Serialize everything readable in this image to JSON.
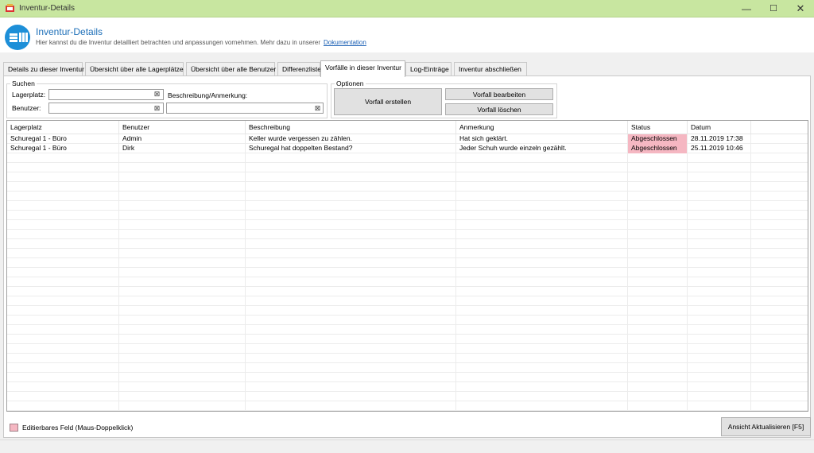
{
  "window": {
    "title": "Inventur-Details"
  },
  "header": {
    "title": "Inventur-Details",
    "subtitle": "Hier kannst du die Inventur detailliert betrachten und anpassungen vornehmen. Mehr dazu in unserer",
    "link": "Dokumentation"
  },
  "tabs": [
    {
      "label": "Details zu dieser Inventur"
    },
    {
      "label": "Übersicht über alle Lagerplätze"
    },
    {
      "label": "Übersicht über alle Benutzer"
    },
    {
      "label": "Differenzliste"
    },
    {
      "label": "Vorfälle in dieser Inventur"
    },
    {
      "label": "Log-Einträge"
    },
    {
      "label": "Inventur abschließen"
    }
  ],
  "search": {
    "group_label": "Suchen",
    "lagerplatz_label": "Lagerplatz:",
    "lagerplatz_value": "",
    "benutzer_label": "Benutzer:",
    "benutzer_value": "",
    "beschreibung_label": "Beschreibung/Anmerkung:",
    "beschreibung_value": "",
    "clear_glyph": "⊠"
  },
  "options": {
    "group_label": "Optionen",
    "create": "Vorfall erstellen",
    "edit": "Vorfall bearbeiten",
    "delete": "Vorfall löschen"
  },
  "table": {
    "columns": [
      "Lagerplatz",
      "Benutzer",
      "Beschreibung",
      "Anmerkung",
      "Status",
      "Datum"
    ],
    "rows": [
      [
        "Schuregal 1 - Büro",
        "Admin",
        "Keller wurde vergessen zu zählen.",
        "Hat sich geklärt.",
        "Abgeschlossen",
        "28.11.2019 17:38"
      ],
      [
        "Schuregal 1 - Büro",
        "Dirk",
        "Schuregal hat doppelten Bestand?",
        "Jeder Schuh wurde einzeln gezählt.",
        "Abgeschlossen",
        "25.11.2019 10:46"
      ]
    ]
  },
  "legend": {
    "text": "Editierbares Feld (Maus-Doppelklick)"
  },
  "refresh": {
    "label": "Ansicht Aktualisieren [F5]"
  },
  "colors": {
    "editable": "#f5b7c2",
    "titlebar": "#c8e6a0",
    "accent": "#1d8fd8"
  }
}
